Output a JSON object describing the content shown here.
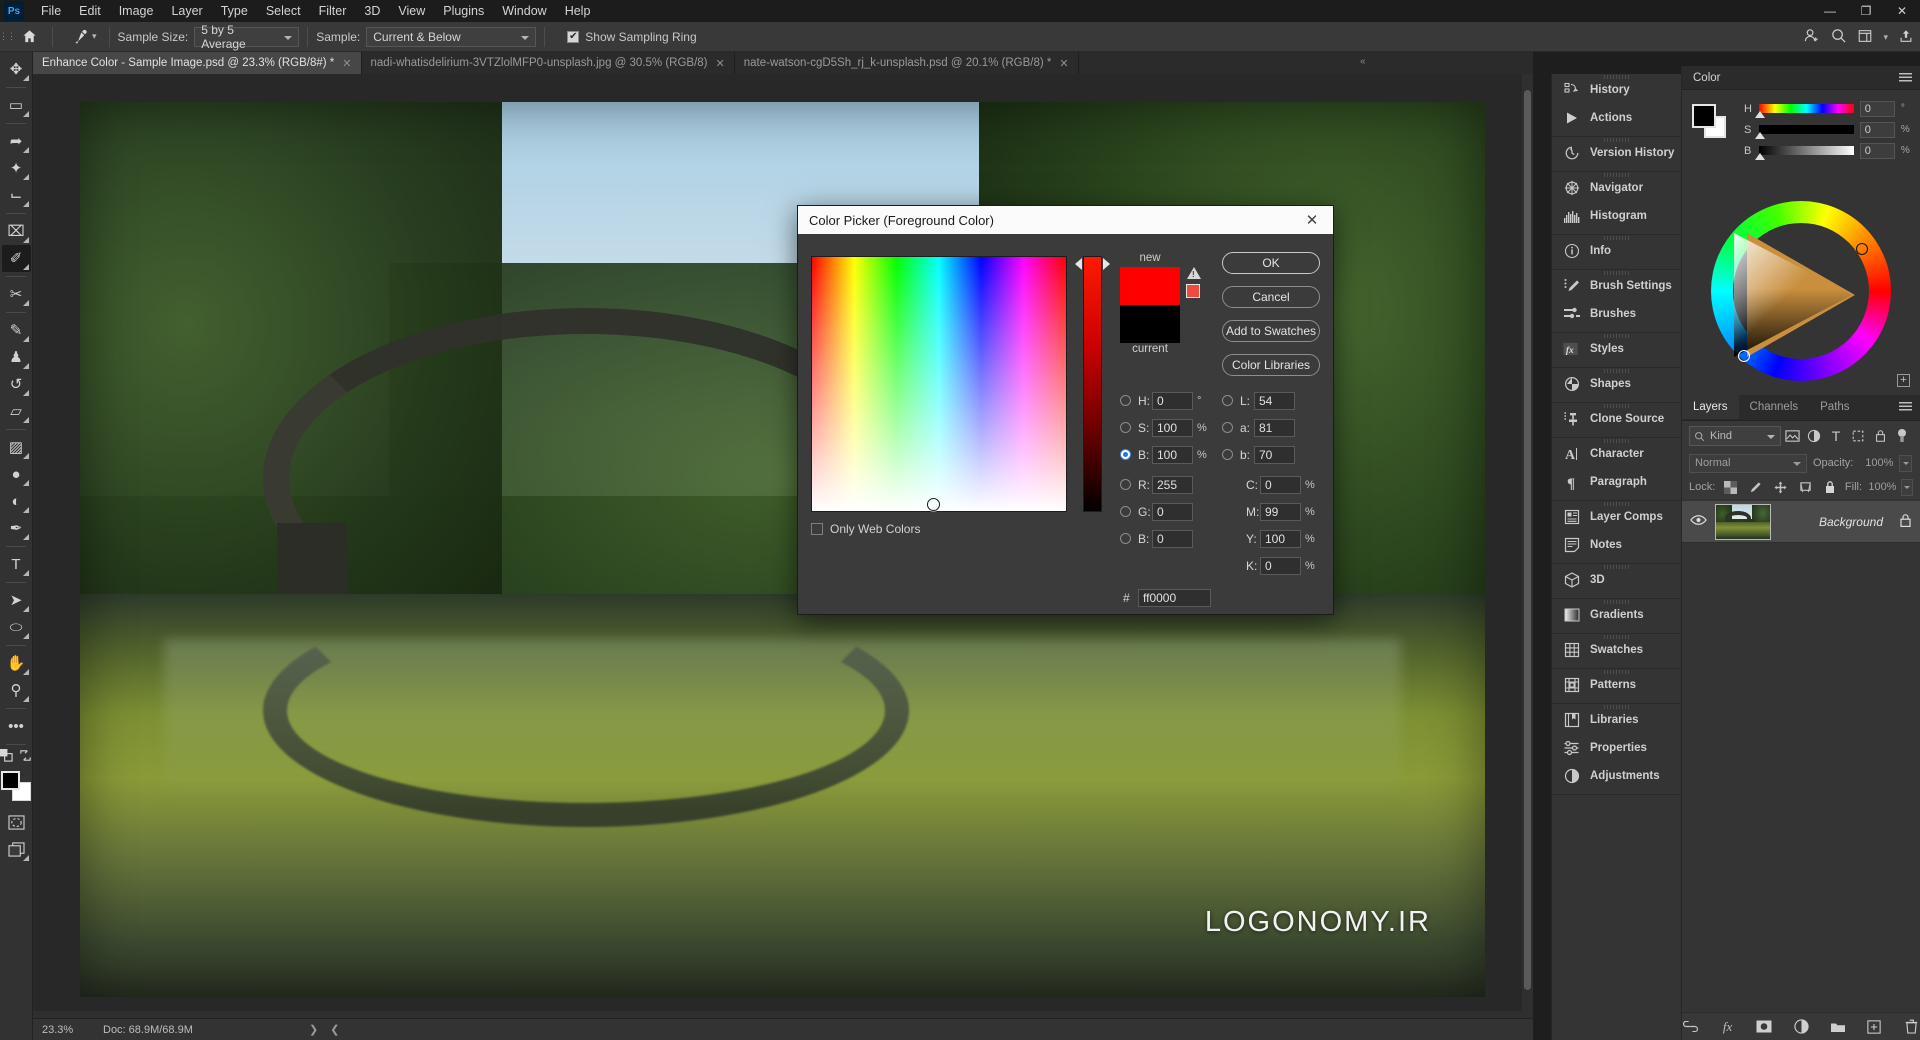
{
  "app": {
    "name": "Ps",
    "logo_bg": "#001e36",
    "logo_fg": "#31a8ff"
  },
  "menubar": {
    "items": [
      "File",
      "Edit",
      "Image",
      "Layer",
      "Type",
      "Select",
      "Filter",
      "3D",
      "View",
      "Plugins",
      "Window",
      "Help"
    ],
    "window_controls": [
      "minimize-icon",
      "restore-icon",
      "close-icon"
    ]
  },
  "optionsbar": {
    "home_icon": "home-icon",
    "tool_icon": "eyedropper-icon",
    "sample_size_label": "Sample Size:",
    "sample_size_value": "5 by 5 Average",
    "sample_label": "Sample:",
    "sample_value": "Current & Below",
    "show_sampling_ring_label": "Show Sampling Ring",
    "show_sampling_ring_checked": true,
    "right_icons": [
      "share-user-icon",
      "search-icon",
      "workspace-icon",
      "chevron-down-icon",
      "export-icon"
    ]
  },
  "tabs": [
    {
      "label": "Enhance Color - Sample Image.psd @ 23.3% (RGB/8#) *",
      "active": true,
      "close": "✕"
    },
    {
      "label": "nadi-whatisdelirium-3VTZlolMFP0-unsplash.jpg @ 30.5% (RGB/8)",
      "active": false,
      "close": "✕"
    },
    {
      "label": "nate-watson-cgD5Sh_rj_k-unsplash.psd @ 20.1% (RGB/8) *",
      "active": false,
      "close": "✕"
    }
  ],
  "toolbar": {
    "tools": [
      {
        "name": "move-tool",
        "glyph": "✥",
        "active": false
      },
      {
        "name": "rectangular-marquee-tool",
        "glyph": "▭",
        "active": false
      },
      {
        "name": "lasso-tool",
        "glyph": "➦",
        "active": false
      },
      {
        "name": "object-selection-tool",
        "glyph": "✦",
        "active": false
      },
      {
        "name": "crop-tool",
        "glyph": "⌙",
        "active": false
      },
      {
        "name": "frame-tool",
        "glyph": "⌧",
        "active": false
      },
      {
        "name": "eyedropper-tool",
        "glyph": "✐",
        "active": true
      },
      {
        "name": "spot-healing-brush-tool",
        "glyph": "✂",
        "active": false
      },
      {
        "name": "brush-tool",
        "glyph": "✎",
        "active": false
      },
      {
        "name": "clone-stamp-tool",
        "glyph": "♟",
        "active": false
      },
      {
        "name": "history-brush-tool",
        "glyph": "↺",
        "active": false
      },
      {
        "name": "eraser-tool",
        "glyph": "▱",
        "active": false
      },
      {
        "name": "gradient-tool",
        "glyph": "▨",
        "active": false
      },
      {
        "name": "blur-tool",
        "glyph": "●",
        "active": false
      },
      {
        "name": "dodge-tool",
        "glyph": "◐",
        "active": false
      },
      {
        "name": "pen-tool",
        "glyph": "✒",
        "active": false
      },
      {
        "name": "type-tool",
        "glyph": "T",
        "active": false
      },
      {
        "name": "path-selection-tool",
        "glyph": "➤",
        "active": false
      },
      {
        "name": "ellipse-tool",
        "glyph": "⬭",
        "active": false
      },
      {
        "name": "hand-tool",
        "glyph": "✋",
        "active": false
      },
      {
        "name": "zoom-tool",
        "glyph": "⚲",
        "active": false
      },
      {
        "name": "edit-toolbar-button",
        "glyph": "•••",
        "active": false
      }
    ],
    "foreground_color": "#000000",
    "background_color": "#ffffff",
    "quickmask_icon": "quick-mask-icon",
    "screenmode_icon": "screen-mode-icon",
    "swap_icon": "swap-colors-icon",
    "default_icon": "default-colors-icon"
  },
  "canvas": {
    "watermark": "LOGONOMY.IR"
  },
  "statusbar": {
    "zoom": "23.3%",
    "doc": "Doc: 68.9M/68.9M"
  },
  "panel_rail": [
    {
      "group": 1,
      "items": [
        {
          "label": "History",
          "icon": "history-icon"
        },
        {
          "label": "Actions",
          "icon": "actions-play-icon"
        }
      ]
    },
    {
      "group": 2,
      "items": [
        {
          "label": "Version History",
          "icon": "version-history-clock-icon"
        }
      ]
    },
    {
      "group": 3,
      "items": [
        {
          "label": "Navigator",
          "icon": "navigator-icon"
        },
        {
          "label": "Histogram",
          "icon": "histogram-icon"
        }
      ]
    },
    {
      "group": 4,
      "items": [
        {
          "label": "Info",
          "icon": "info-circle-icon"
        }
      ]
    },
    {
      "group": 5,
      "items": [
        {
          "label": "Brush Settings",
          "icon": "brush-settings-icon"
        },
        {
          "label": "Brushes",
          "icon": "brushes-icon"
        }
      ]
    },
    {
      "group": 6,
      "items": [
        {
          "label": "Styles",
          "icon": "styles-fx-icon"
        }
      ]
    },
    {
      "group": 7,
      "items": [
        {
          "label": "Shapes",
          "icon": "shapes-icon"
        }
      ]
    },
    {
      "group": 8,
      "items": [
        {
          "label": "Clone Source",
          "icon": "clone-source-icon"
        }
      ]
    },
    {
      "group": 9,
      "items": [
        {
          "label": "Character",
          "icon": "character-icon"
        },
        {
          "label": "Paragraph",
          "icon": "paragraph-pilcrow-icon"
        }
      ]
    },
    {
      "group": 10,
      "items": [
        {
          "label": "Layer Comps",
          "icon": "layer-comps-icon"
        },
        {
          "label": "Notes",
          "icon": "notes-icon"
        }
      ]
    },
    {
      "group": 11,
      "items": [
        {
          "label": "3D",
          "icon": "cube-3d-icon"
        }
      ]
    },
    {
      "group": 12,
      "items": [
        {
          "label": "Gradients",
          "icon": "gradients-icon"
        }
      ]
    },
    {
      "group": 13,
      "items": [
        {
          "label": "Swatches",
          "icon": "swatches-grid-icon"
        }
      ]
    },
    {
      "group": 14,
      "items": [
        {
          "label": "Patterns",
          "icon": "patterns-icon"
        }
      ]
    },
    {
      "group": 15,
      "items": [
        {
          "label": "Libraries",
          "icon": "libraries-book-icon"
        },
        {
          "label": "Properties",
          "icon": "properties-sliders-icon"
        },
        {
          "label": "Adjustments",
          "icon": "adjustments-circle-icon"
        }
      ]
    }
  ],
  "color_panel": {
    "title": "Color",
    "foreground": "#000000",
    "background": "#ffffff",
    "rows": [
      {
        "label": "H",
        "value": "0",
        "unit": "°",
        "track": "hue"
      },
      {
        "label": "S",
        "value": "0",
        "unit": "%",
        "track": "sat"
      },
      {
        "label": "B",
        "value": "0",
        "unit": "%",
        "track": "bri"
      }
    ],
    "menu_icon": "panel-menu-icon",
    "wheel_add_icon": "add-swatch-icon"
  },
  "layers_panel": {
    "tabs": [
      "Layers",
      "Channels",
      "Paths"
    ],
    "active_tab": "Layers",
    "filter_placeholder": "Kind",
    "filter_icons": [
      "filter-image-icon",
      "filter-adjustment-icon",
      "filter-type-icon",
      "filter-shape-icon",
      "filter-smart-icon"
    ],
    "filter_toggle_icon": "filter-toggle-icon",
    "blend_mode": "Normal",
    "opacity_label": "Opacity:",
    "opacity_value": "100%",
    "lock_label": "Lock:",
    "lock_icons": [
      "lock-transparent-icon",
      "lock-image-icon",
      "lock-position-icon",
      "lock-artboard-icon",
      "lock-all-icon"
    ],
    "fill_label": "Fill:",
    "fill_value": "100%",
    "layers": [
      {
        "name": "Background",
        "visible": true,
        "locked": true,
        "thumb": "photo-thumbnail"
      }
    ],
    "bottom_icons": [
      "link-layers-icon",
      "add-layer-style-fx-icon",
      "add-layer-mask-icon",
      "new-adjustment-layer-icon",
      "new-group-icon",
      "new-layer-icon",
      "delete-layer-icon"
    ]
  },
  "color_picker": {
    "title": "Color Picker (Foreground Color)",
    "close_glyph": "✕",
    "new_label": "new",
    "current_label": "current",
    "new_color": "#ff0000",
    "current_color": "#000000",
    "out_of_gamut_icon": "gamut-warning-icon",
    "out_of_gamut_chip": "#f24a3a",
    "buttons": [
      {
        "label": "OK",
        "primary": true
      },
      {
        "label": "Cancel",
        "primary": false
      },
      {
        "label": "Add to Swatches",
        "primary": false
      },
      {
        "label": "Color Libraries",
        "primary": false
      }
    ],
    "only_web_colors_label": "Only Web Colors",
    "only_web_colors_checked": false,
    "hsb": [
      {
        "label": "H",
        "value": "0",
        "unit": "°",
        "selected": false
      },
      {
        "label": "S",
        "value": "100",
        "unit": "%",
        "selected": false
      },
      {
        "label": "B",
        "value": "100",
        "unit": "%",
        "selected": true
      }
    ],
    "lab": [
      {
        "label": "L",
        "value": "54",
        "unit": "",
        "selected": false
      },
      {
        "label": "a",
        "value": "81",
        "unit": "",
        "selected": false
      },
      {
        "label": "b",
        "value": "70",
        "unit": "",
        "selected": false
      }
    ],
    "rgb": [
      {
        "label": "R",
        "value": "255",
        "unit": "",
        "selected": false
      },
      {
        "label": "G",
        "value": "0",
        "unit": "",
        "selected": false
      },
      {
        "label": "B",
        "value": "0",
        "unit": "",
        "selected": false
      }
    ],
    "cmyk": [
      {
        "label": "C",
        "value": "0",
        "unit": "%"
      },
      {
        "label": "M",
        "value": "99",
        "unit": "%"
      },
      {
        "label": "Y",
        "value": "100",
        "unit": "%"
      },
      {
        "label": "K",
        "value": "0",
        "unit": "%"
      }
    ],
    "hex_symbol": "#",
    "hex_value": "ff0000"
  }
}
